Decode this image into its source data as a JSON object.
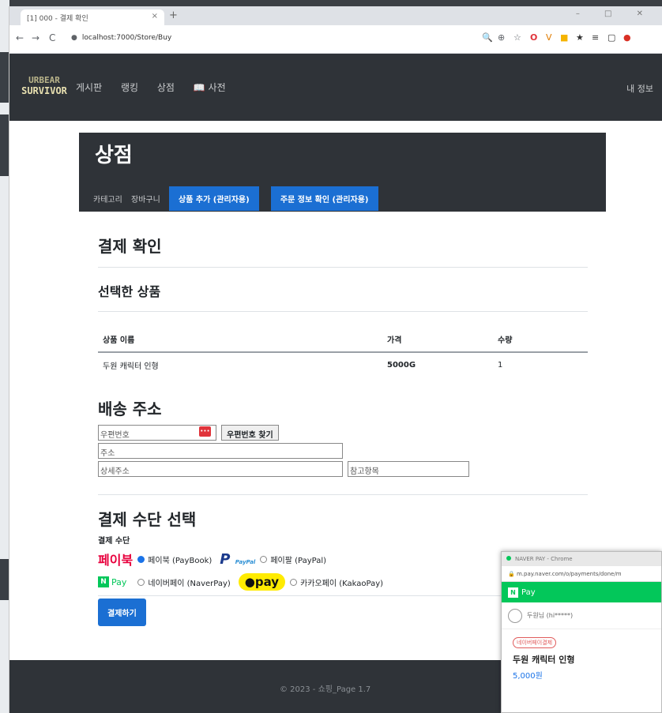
{
  "browser": {
    "tab_title": "[1] 000 - 결제 확인",
    "tab_close": "×",
    "tab_new": "+",
    "window_controls": "–  □  ✕",
    "back": "←",
    "forward": "→",
    "reload": "C",
    "url": "localhost:7000/Store/Buy",
    "extensions": [
      "🔍",
      "⊕",
      "☆",
      "O",
      "V",
      "■",
      "★",
      "≡",
      "▢",
      "●"
    ]
  },
  "nav": {
    "logo_top": "URBEAR",
    "logo_bottom": "SURVIVOR",
    "links": [
      "게시판",
      "랭킹",
      "상점",
      "📖 사전"
    ],
    "my_info": "내 정보"
  },
  "shop": {
    "title": "상점",
    "tabs": [
      "카테고리",
      "장바구니"
    ],
    "admin_tabs": [
      "상품 추가 (관리자용)",
      "주문 정보 확인 (관리자용)"
    ]
  },
  "checkout": {
    "heading": "결제 확인",
    "selected_heading": "선택한 상품",
    "table": {
      "headers": [
        "상품 이름",
        "가격",
        "수량"
      ],
      "rows": [
        [
          "두원 캐릭터 인형",
          "5000G",
          "1"
        ]
      ]
    },
    "shipping_heading": "배송 주소",
    "zip_placeholder": "우편번호",
    "zip_button": "우편번호 찾기",
    "address_placeholder": "주소",
    "detail_placeholder": "상세주소",
    "extra_placeholder": "참고항목",
    "method_heading": "결제 수단 선택",
    "method_label": "결제 수단",
    "methods": {
      "paybook_logo": "페이북",
      "paybook_label": "페이북 (PayBook)",
      "paypal_logo": "P",
      "paypal_logo_text": "PayPal",
      "paypal_label": "페이팔 (PayPal)",
      "naver_logo": "N",
      "naver_logo_text": "Pay",
      "naver_label": "네이버페이 (NaverPay)",
      "kakao_logo": "●pay",
      "kakao_label": "카카오페이 (KakaoPay)"
    },
    "pay_button": "결제하기"
  },
  "footer": {
    "copyright": "© 2023 - 쇼핑_Page 1.7"
  },
  "popup": {
    "window_title": "NAVER PAY - Chrome",
    "url": "m.pay.naver.com/o/payments/done/m",
    "bar_logo": "N",
    "bar_text": "Pay",
    "user": "두원님 (hi*****)",
    "badge": "네이버페이결제",
    "item": "두원 캐릭터 인형",
    "price": "5,000원"
  },
  "colors": {
    "primary": "#1b6fd3",
    "dark": "#2f3338",
    "naver": "#03c75a",
    "kakao": "#ffeb00",
    "paybook": "#e8003d"
  }
}
